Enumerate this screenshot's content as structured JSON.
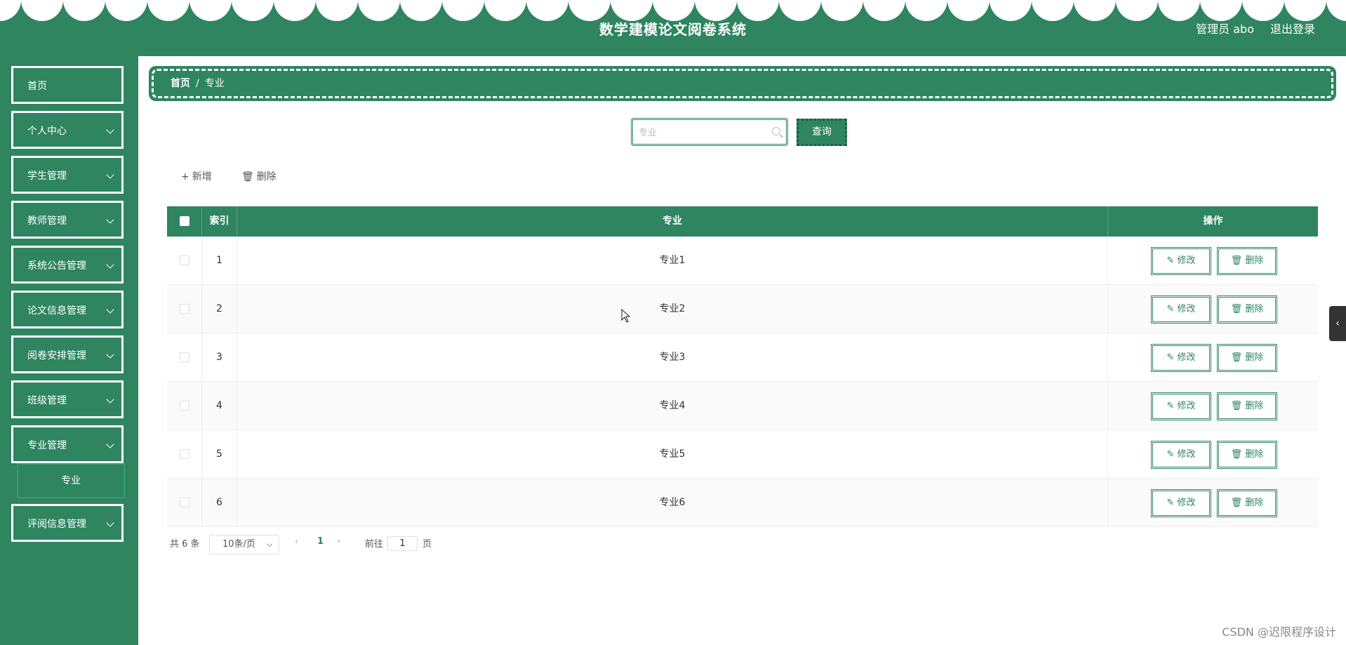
{
  "header": {
    "title": "数学建模论文阅卷系统",
    "user": "管理员 abo",
    "logout": "退出登录"
  },
  "sidebar": {
    "items": [
      {
        "label": "首页",
        "has_children": false
      },
      {
        "label": "个人中心",
        "has_children": true
      },
      {
        "label": "学生管理",
        "has_children": true
      },
      {
        "label": "教师管理",
        "has_children": true
      },
      {
        "label": "系统公告管理",
        "has_children": true
      },
      {
        "label": "论文信息管理",
        "has_children": true
      },
      {
        "label": "阅卷安排管理",
        "has_children": true
      },
      {
        "label": "班级管理",
        "has_children": true
      },
      {
        "label": "专业管理",
        "has_children": true
      },
      {
        "label": "评阅信息管理",
        "has_children": true
      }
    ],
    "sub_item": "专业"
  },
  "breadcrumb": {
    "home": "首页",
    "sep": "/",
    "current": "专业"
  },
  "search": {
    "placeholder": "专业",
    "button": "查询"
  },
  "toolbar": {
    "add": "新增",
    "delete": "删除"
  },
  "table": {
    "headers": {
      "index": "索引",
      "major": "专业",
      "actions": "操作"
    },
    "rows": [
      {
        "index": "1",
        "major": "专业1"
      },
      {
        "index": "2",
        "major": "专业2"
      },
      {
        "index": "3",
        "major": "专业3"
      },
      {
        "index": "4",
        "major": "专业4"
      },
      {
        "index": "5",
        "major": "专业5"
      },
      {
        "index": "6",
        "major": "专业6"
      }
    ],
    "edit_label": "修改",
    "delete_label": "删除"
  },
  "pagination": {
    "total": "共 6 条",
    "page_size": "10条/页",
    "current_page": "1",
    "goto_label": "前往",
    "goto_value": "1",
    "page_suffix": "页"
  },
  "watermark": "CSDN @迟限程序设计",
  "colors": {
    "primary": "#2e8560"
  }
}
